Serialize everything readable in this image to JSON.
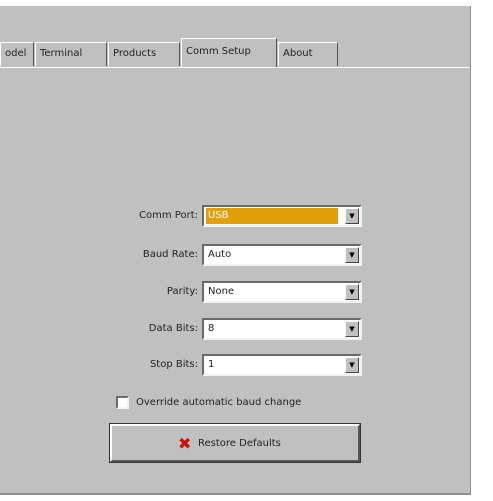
{
  "tabs": [
    {
      "label": "odel",
      "active": false
    },
    {
      "label": "Terminal",
      "active": false
    },
    {
      "label": "Products",
      "active": false
    },
    {
      "label": "Comm Setup",
      "active": true
    },
    {
      "label": "About",
      "active": false
    }
  ],
  "form": {
    "comm_port": {
      "label": "Comm Port:",
      "value": "USB"
    },
    "baud_rate": {
      "label": "Baud Rate:",
      "value": "Auto"
    },
    "parity": {
      "label": "Parity:",
      "value": "None"
    },
    "data_bits": {
      "label": "Data Bits:",
      "value": "8"
    },
    "stop_bits": {
      "label": "Stop Bits:",
      "value": "1"
    }
  },
  "override_checkbox": {
    "label": "Override automatic baud change",
    "checked": false
  },
  "restore_button": {
    "label": "Restore Defaults",
    "icon": "red-x-icon"
  },
  "colors": {
    "panel": "#c0c0c0",
    "selection": "#e1a009",
    "icon_red": "#d01010"
  }
}
